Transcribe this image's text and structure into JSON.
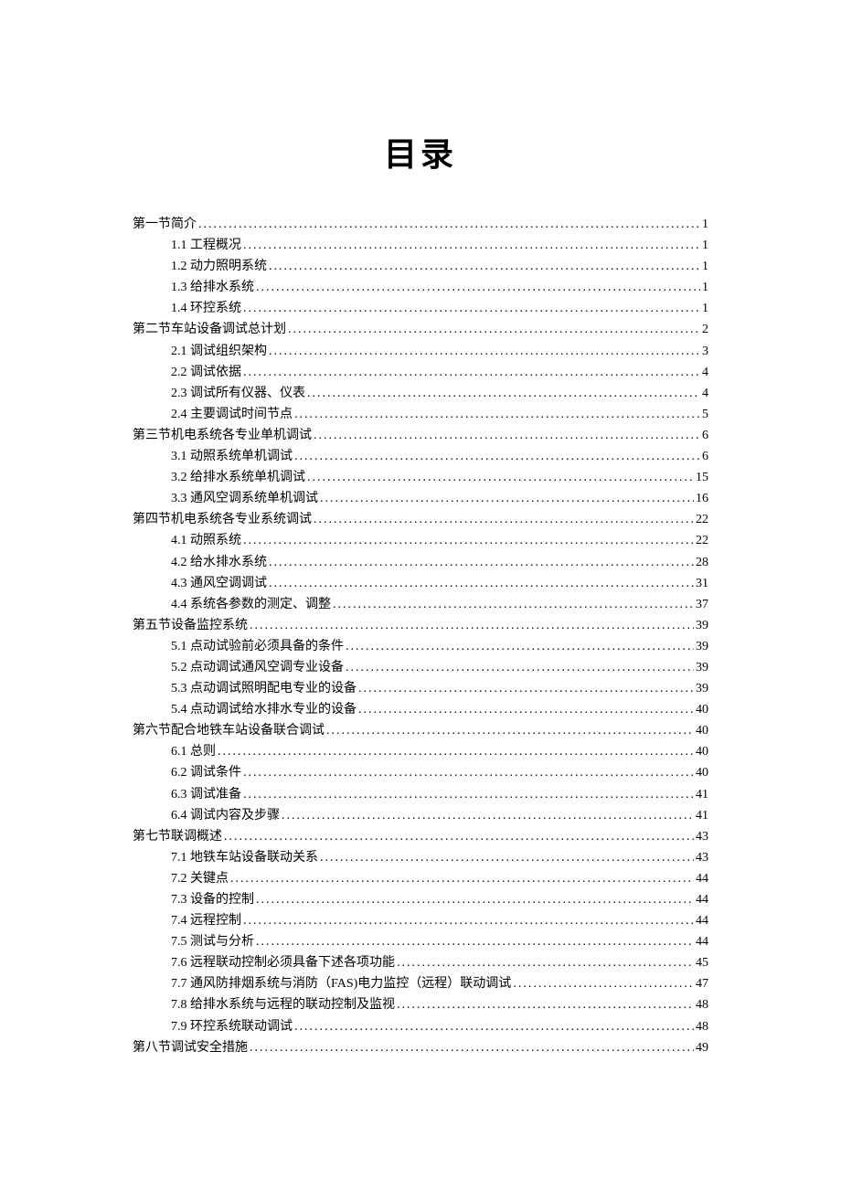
{
  "title": "目录",
  "toc": [
    {
      "level": 1,
      "label": "第一节简介",
      "page": "1"
    },
    {
      "level": 2,
      "label": "1.1 工程概况",
      "page": "1"
    },
    {
      "level": 2,
      "label": "1.2 动力照明系统",
      "page": "1"
    },
    {
      "level": 2,
      "label": "1.3 给排水系统",
      "page": "1"
    },
    {
      "level": 2,
      "label": "1.4 环控系统",
      "page": "1"
    },
    {
      "level": 1,
      "label": "第二节车站设备调试总计划",
      "page": "2"
    },
    {
      "level": 2,
      "label": "2.1 调试组织架构",
      "page": "3"
    },
    {
      "level": 2,
      "label": "2.2 调试依据",
      "page": "4"
    },
    {
      "level": 2,
      "label": "2.3 调试所有仪器、仪表",
      "page": "4"
    },
    {
      "level": 2,
      "label": "2.4 主要调试时间节点",
      "page": "5"
    },
    {
      "level": 1,
      "label": "第三节机电系统各专业单机调试",
      "page": "6"
    },
    {
      "level": 2,
      "label": "3.1 动照系统单机调试",
      "page": "6"
    },
    {
      "level": 2,
      "label": "3.2 给排水系统单机调试",
      "page": "15"
    },
    {
      "level": 2,
      "label": "3.3 通风空调系统单机调试",
      "page": "16"
    },
    {
      "level": 1,
      "label": "第四节机电系统各专业系统调试",
      "page": "22"
    },
    {
      "level": 2,
      "label": "4.1 动照系统",
      "page": "22"
    },
    {
      "level": 2,
      "label": "4.2 给水排水系统",
      "page": "28"
    },
    {
      "level": 2,
      "label": "4.3 通风空调调试",
      "page": "31"
    },
    {
      "level": 2,
      "label": "4.4 系统各参数的测定、调整",
      "page": "37"
    },
    {
      "level": 1,
      "label": "第五节设备监控系统",
      "page": "39"
    },
    {
      "level": 2,
      "label": "5.1 点动试验前必须具备的条件",
      "page": "39"
    },
    {
      "level": 2,
      "label": "5.2 点动调试通风空调专业设备",
      "page": "39"
    },
    {
      "level": 2,
      "label": "5.3 点动调试照明配电专业的设备",
      "page": "39"
    },
    {
      "level": 2,
      "label": "5.4 点动调试给水排水专业的设备",
      "page": "40"
    },
    {
      "level": 1,
      "label": "第六节配合地铁车站设备联合调试",
      "page": "40"
    },
    {
      "level": 2,
      "label": "6.1 总则",
      "page": "40"
    },
    {
      "level": 2,
      "label": "6.2 调试条件",
      "page": "40"
    },
    {
      "level": 2,
      "label": "6.3 调试准备",
      "page": "41"
    },
    {
      "level": 2,
      "label": "6.4 调试内容及步骤",
      "page": "41"
    },
    {
      "level": 1,
      "label": "第七节联调概述",
      "page": "43"
    },
    {
      "level": 2,
      "label": "7.1 地铁车站设备联动关系",
      "page": "43"
    },
    {
      "level": 2,
      "label": "7.2 关键点",
      "page": "44"
    },
    {
      "level": 2,
      "label": "7.3 设备的控制",
      "page": "44"
    },
    {
      "level": 2,
      "label": "7.4 远程控制",
      "page": "44"
    },
    {
      "level": 2,
      "label": "7.5 测试与分析",
      "page": "44"
    },
    {
      "level": 2,
      "label": "7.6 远程联动控制必须具备下述各项功能",
      "page": "45"
    },
    {
      "level": 2,
      "label": "7.7 通风防排烟系统与消防（FAS)电力监控（远程）联动调试",
      "page": "47"
    },
    {
      "level": 2,
      "label": "7.8 给排水系统与远程的联动控制及监视",
      "page": "48"
    },
    {
      "level": 2,
      "label": "7.9 环控系统联动调试",
      "page": "48"
    },
    {
      "level": 1,
      "label": "第八节调试安全措施",
      "page": "49"
    }
  ]
}
